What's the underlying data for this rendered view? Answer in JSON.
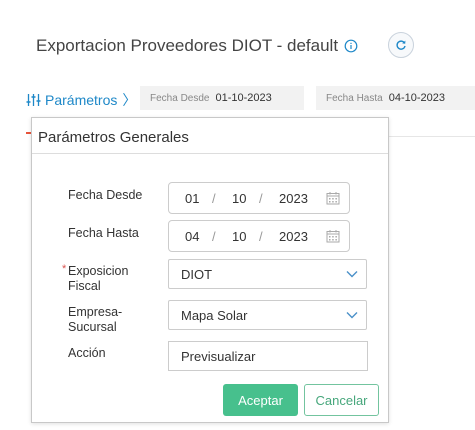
{
  "header": {
    "title": "Exportacion Proveedores DIOT - default",
    "info_icon": "info-icon",
    "refresh_icon": "refresh-icon"
  },
  "params_bar": {
    "link_label": "Parámetros",
    "link_chevron": "〉",
    "filters": [
      {
        "label": "Fecha Desde",
        "value": "01-10-2023"
      },
      {
        "label": "Fecha Hasta",
        "value": "04-10-2023"
      }
    ]
  },
  "popover": {
    "title": "Parámetros Generales",
    "fecha_desde": {
      "label": "Fecha Desde",
      "day": "01",
      "month": "10",
      "year": "2023",
      "sep": "/"
    },
    "fecha_hasta": {
      "label": "Fecha Hasta",
      "day": "04",
      "month": "10",
      "year": "2023",
      "sep": "/"
    },
    "exposicion": {
      "label_line1": "Exposicion",
      "label_line2": "Fiscal",
      "required_mark": "*",
      "value": "DIOT"
    },
    "empresa": {
      "label_line1": "Empresa-",
      "label_line2": "Sucursal",
      "value": "Mapa Solar"
    },
    "accion": {
      "label": "Acción",
      "value": "Previsualizar"
    },
    "accept_label": "Aceptar",
    "cancel_label": "Cancelar"
  },
  "colors": {
    "link_blue": "#1e88c8",
    "accept_green": "#47c08d",
    "required_red": "#d9534f"
  }
}
